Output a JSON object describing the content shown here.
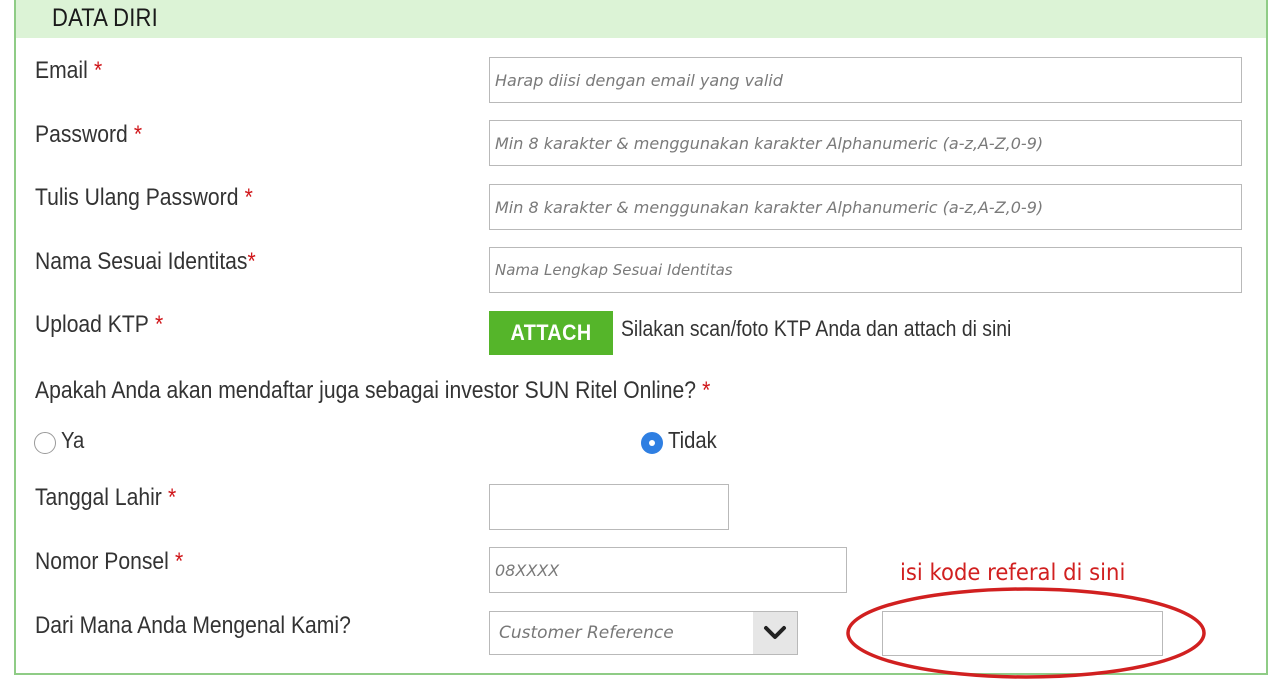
{
  "section": {
    "title": "DATA DIRI"
  },
  "fields": {
    "email": {
      "label": "Email",
      "required": "*",
      "placeholder": "Harap diisi dengan email yang valid",
      "value": ""
    },
    "password": {
      "label": "Password",
      "required": "*",
      "placeholder": "Min 8 karakter & menggunakan karakter Alphanumeric (a-z,A-Z,0-9)",
      "value": ""
    },
    "confirm_password": {
      "label": "Tulis Ulang Password",
      "required": "*",
      "placeholder": "Min 8 karakter & menggunakan karakter Alphanumeric (a-z,A-Z,0-9)",
      "value": ""
    },
    "full_name": {
      "label": "Nama Sesuai Identitas",
      "required": "*",
      "placeholder": "Nama Lengkap Sesuai Identitas",
      "value": ""
    },
    "ktp": {
      "label": "Upload KTP",
      "required": "*",
      "button_label": "ATTACH",
      "hint": "Silakan scan/foto KTP Anda dan attach di sini"
    },
    "investor_question": {
      "label": "Apakah Anda akan mendaftar juga sebagai investor SUN Ritel Online?",
      "required": "*",
      "options": [
        {
          "label": "Ya",
          "selected": false
        },
        {
          "label": "Tidak",
          "selected": true
        }
      ]
    },
    "birth_date": {
      "label": "Tanggal Lahir",
      "required": "*",
      "value": ""
    },
    "phone": {
      "label": "Nomor Ponsel",
      "required": "*",
      "placeholder": "08XXXX",
      "value": ""
    },
    "referral_source": {
      "label": "Dari Mana Anda Mengenal Kami?",
      "selected": "Customer Reference",
      "referral_code_value": ""
    }
  },
  "annotation": {
    "note": "isi kode referal di sini",
    "color": "#d12020"
  },
  "colors": {
    "header_bg": "#dcf3d6",
    "panel_border": "#8fcc86",
    "attach_button": "#55b52a",
    "required_star": "#d0171b",
    "radio_selected": "#2f7fe2"
  },
  "icons": {
    "select_arrow": "chevron-down-icon"
  }
}
